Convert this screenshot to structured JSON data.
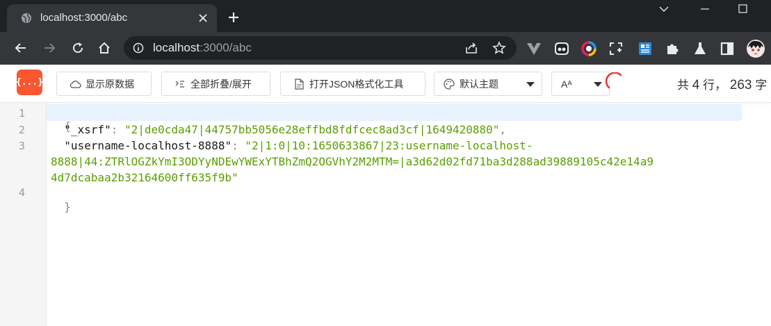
{
  "browser": {
    "tab_title": "localhost:3000/abc",
    "url_host": "localhost",
    "url_rest": ":3000/abc"
  },
  "viewer": {
    "logo_text": "{...}",
    "raw_button": "显示原数据",
    "collapse_button": "全部折叠/展开",
    "formatter_button": "打开JSON格式化工具",
    "theme_select": "默认主题",
    "font_select": "Aᴬ",
    "stats": {
      "prefix": "共",
      "line_count": "4",
      "line_unit": "行，",
      "char_count": "263",
      "char_unit": "字"
    }
  },
  "editor": {
    "line_numbers": [
      "1",
      "2",
      "3",
      "4"
    ],
    "open_brace": "{",
    "close_brace": "}",
    "entries": [
      {
        "key": "\"_xsrf\"",
        "value": "\"2|de0cda47|44757bb5056e28effbd8fdfcec8ad3cf|1649420880\""
      },
      {
        "key": "\"username-localhost-8888\"",
        "value_line1": "\"2|1:0|10:1650633867|23:username-localhost-",
        "value_line2": "8888|44:ZTRlOGZkYmI3ODYyNDEwYWExYTBhZmQ2OGVhY2M2MTM=|a3d62d02fd71ba3d288ad39889105c42e14a9",
        "value_line3": "4d7dcabaa2b32164600ff635f9b\""
      }
    ]
  },
  "colors": {
    "logo": "#f9572f",
    "string": "#5a9e00",
    "key": "#1a1a1a",
    "active_line": "#e8f2ff"
  }
}
